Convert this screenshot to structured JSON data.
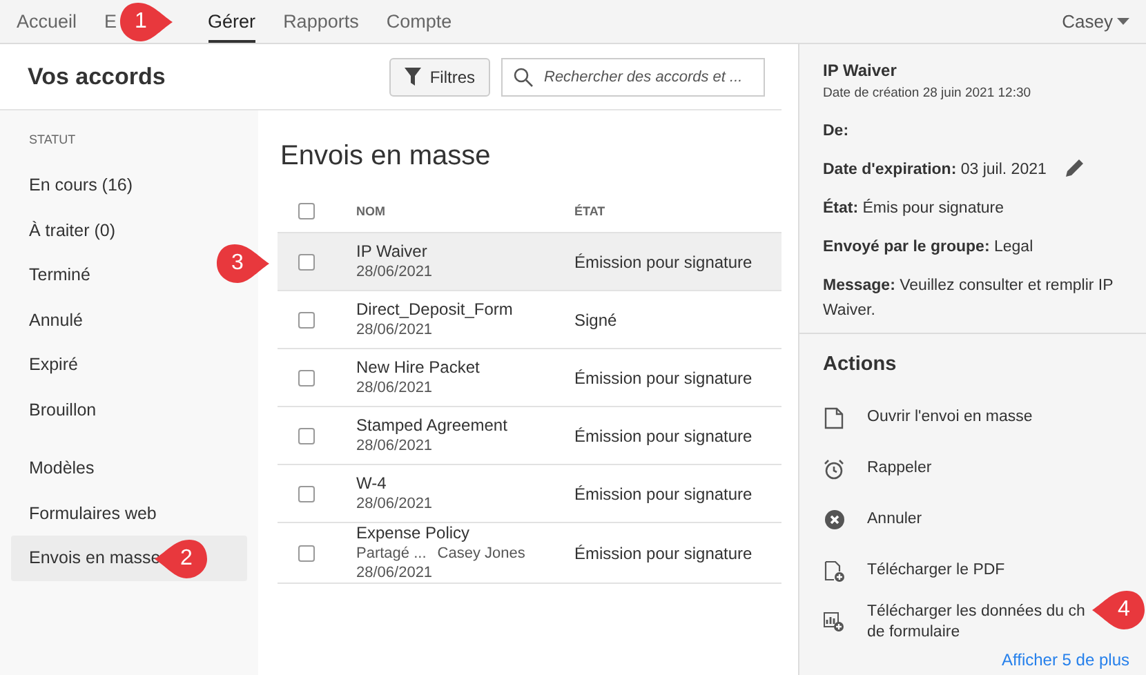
{
  "nav": {
    "tabs": [
      {
        "label": "Accueil",
        "selected": false
      },
      {
        "label": "E",
        "selected": false
      },
      {
        "label": "Gérer",
        "selected": true
      },
      {
        "label": "Rapports",
        "selected": false
      },
      {
        "label": "Compte",
        "selected": false
      }
    ],
    "user": "Casey"
  },
  "header": {
    "title": "Vos accords",
    "filter_button": "Filtres",
    "search": {
      "placeholder": "Rechercher des accords et ..."
    }
  },
  "sidebar": {
    "heading": "STATUT",
    "groups": [
      [
        {
          "label": "En cours (16)",
          "selected": false
        },
        {
          "label": "À traiter (0)",
          "selected": false
        },
        {
          "label": "Terminé",
          "selected": false
        },
        {
          "label": "Annulé",
          "selected": false
        },
        {
          "label": "Expiré",
          "selected": false
        },
        {
          "label": "Brouillon",
          "selected": false
        }
      ],
      [
        {
          "label": "Modèles",
          "selected": false
        },
        {
          "label": "Formulaires web",
          "selected": false
        },
        {
          "label": "Envois en masse",
          "selected": true
        }
      ]
    ]
  },
  "list": {
    "title": "Envois en masse",
    "select_all_checked": false,
    "columns": [
      "NOM",
      "ÉTAT"
    ],
    "rows": [
      {
        "name": "IP Waiver",
        "date": "28/06/2021",
        "state": "Émission pour signature",
        "checked": false,
        "selected": true
      },
      {
        "name": "Direct_Deposit_Form",
        "date": "28/06/2021",
        "state": "Signé",
        "checked": false,
        "selected": false
      },
      {
        "name": "New Hire Packet",
        "date": "28/06/2021",
        "state": "Émission pour signature",
        "checked": false,
        "selected": false
      },
      {
        "name": "Stamped Agreement",
        "date": "28/06/2021",
        "state": "Émission pour signature",
        "checked": false,
        "selected": false
      },
      {
        "name": "W-4",
        "date": "28/06/2021",
        "state": "Émission pour signature",
        "checked": false,
        "selected": false
      },
      {
        "name": "Expense Policy",
        "shared": "Partagé ...",
        "owner": "Casey Jones",
        "date": "28/06/2021",
        "state": "Émission pour signature",
        "checked": false,
        "selected": false
      }
    ]
  },
  "details": {
    "title": "IP Waiver",
    "created": "Date de création 28 juin 2021 12:30",
    "fields": [
      {
        "label": "De:"
      },
      {
        "label": "Date d'expiration:",
        "value": "03 juil. 2021",
        "editable": true
      },
      {
        "label": "État:",
        "value": "Émis pour signature"
      },
      {
        "label": "Envoyé par le groupe:",
        "value": "Legal"
      },
      {
        "label": "Message:",
        "value": "Veuillez consulter et remplir IP Waiver."
      }
    ],
    "actions_title": "Actions",
    "actions": [
      {
        "kind": "document",
        "lines": [
          "Ouvrir l'envoi en masse"
        ]
      },
      {
        "kind": "alarm",
        "lines": [
          "Rappeler"
        ]
      },
      {
        "kind": "cancel",
        "lines": [
          "Annuler"
        ]
      },
      {
        "kind": "pdf",
        "lines": [
          "Télécharger le PDF"
        ]
      },
      {
        "kind": "data",
        "lines": [
          "Télécharger les données du ch",
          "de formulaire"
        ]
      }
    ],
    "more_link": "Afficher 5 de plus"
  },
  "callouts": [
    {
      "number": "1",
      "kind": "right"
    },
    {
      "number": "2",
      "kind": "left"
    },
    {
      "number": "3",
      "kind": "right"
    },
    {
      "number": "4",
      "kind": "left"
    }
  ]
}
